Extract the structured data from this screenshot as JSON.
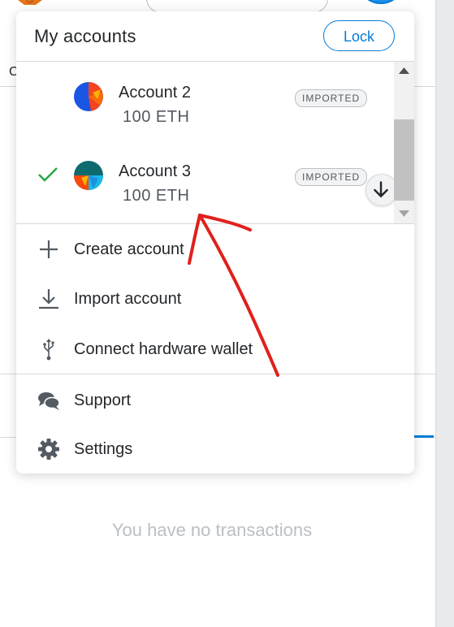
{
  "background": {
    "partial_letter": "C",
    "empty_message": "You have no transactions"
  },
  "menu": {
    "title": "My accounts",
    "lock_label": "Lock",
    "accounts": [
      {
        "name": "Account 2",
        "balance": "100 ETH",
        "badge": "IMPORTED",
        "selected": false
      },
      {
        "name": "Account 3",
        "balance": "100 ETH",
        "badge": "IMPORTED",
        "selected": true
      }
    ],
    "actions": [
      {
        "label": "Create account",
        "icon": "plus-icon"
      },
      {
        "label": "Import account",
        "icon": "import-icon"
      },
      {
        "label": "Connect hardware wallet",
        "icon": "usb-icon"
      }
    ],
    "footer": [
      {
        "label": "Support",
        "icon": "chat-bubbles-icon"
      },
      {
        "label": "Settings",
        "icon": "gear-icon"
      }
    ]
  },
  "colors": {
    "accent": "#037dd6",
    "check": "#28a745",
    "annotation": "#e0201c"
  }
}
